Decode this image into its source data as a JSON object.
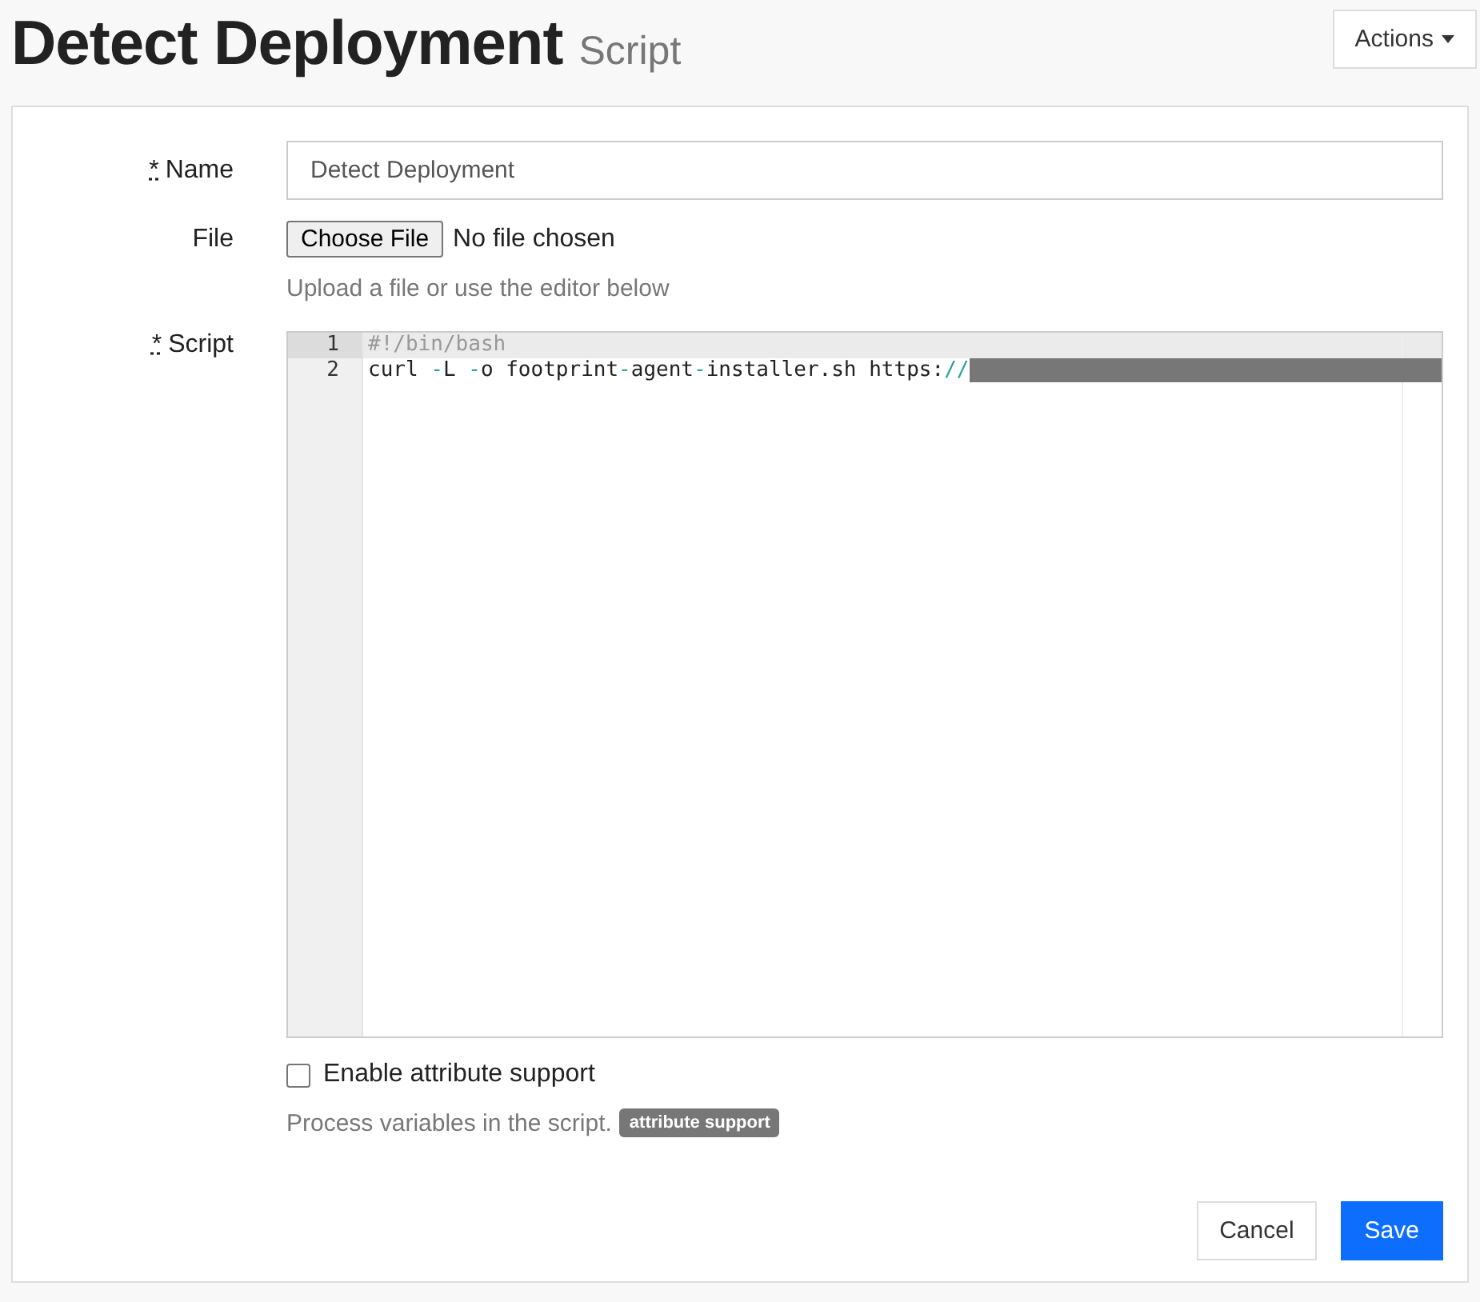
{
  "header": {
    "title": "Detect Deployment",
    "subtitle": "Script",
    "actions_button": "Actions"
  },
  "form": {
    "name_field": {
      "required_mark": "*",
      "label": "Name",
      "value": "Detect Deployment"
    },
    "file_field": {
      "label": "File",
      "button": "Choose File",
      "status": "No file chosen",
      "help": "Upload a file or use the editor below"
    },
    "script_field": {
      "required_mark": "*",
      "label": "Script",
      "lines": [
        {
          "number": "1",
          "active": true,
          "redacted": false,
          "tokens": [
            {
              "kind": "comment",
              "text": "#!/bin/bash"
            }
          ]
        },
        {
          "number": "2",
          "active": false,
          "redacted": true,
          "tokens": [
            {
              "kind": "plain",
              "text": "curl "
            },
            {
              "kind": "operator",
              "text": "-"
            },
            {
              "kind": "plain",
              "text": "L "
            },
            {
              "kind": "operator",
              "text": "-"
            },
            {
              "kind": "plain",
              "text": "o footprint"
            },
            {
              "kind": "operator",
              "text": "-"
            },
            {
              "kind": "plain",
              "text": "agent"
            },
            {
              "kind": "operator",
              "text": "-"
            },
            {
              "kind": "plain",
              "text": "installer.sh https:"
            },
            {
              "kind": "operator",
              "text": "//"
            }
          ]
        }
      ]
    },
    "attribute_checkbox": {
      "label": "Enable attribute support",
      "checked": false
    },
    "attribute_help": {
      "text": "Process variables in the script.",
      "badge": "attribute support"
    },
    "buttons": {
      "cancel": "Cancel",
      "save": "Save"
    }
  }
}
